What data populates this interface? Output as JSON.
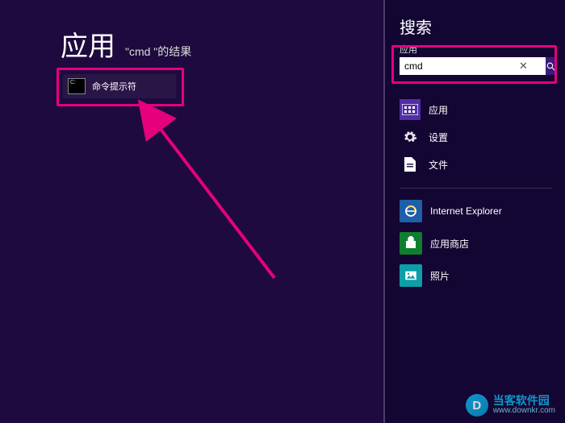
{
  "main": {
    "title": "应用",
    "subtitle": "\"cmd \"的结果",
    "result": {
      "label": "命令提示符"
    }
  },
  "sidebar": {
    "title": "搜索",
    "scope_label": "应用",
    "search": {
      "value": "cmd"
    },
    "categories": [
      {
        "label": "应用",
        "icon": "apps",
        "selected": true
      },
      {
        "label": "设置",
        "icon": "gear",
        "selected": false
      },
      {
        "label": "文件",
        "icon": "file",
        "selected": false
      }
    ],
    "apps": [
      {
        "label": "Internet Explorer",
        "icon": "ie",
        "color": "#1f5fa8"
      },
      {
        "label": "应用商店",
        "icon": "store",
        "color": "#0f7f2d"
      },
      {
        "label": "照片",
        "icon": "photos",
        "color": "#0d9ea8"
      }
    ]
  },
  "watermark": {
    "brand": "当客软件园",
    "url": "www.downkr.com"
  }
}
